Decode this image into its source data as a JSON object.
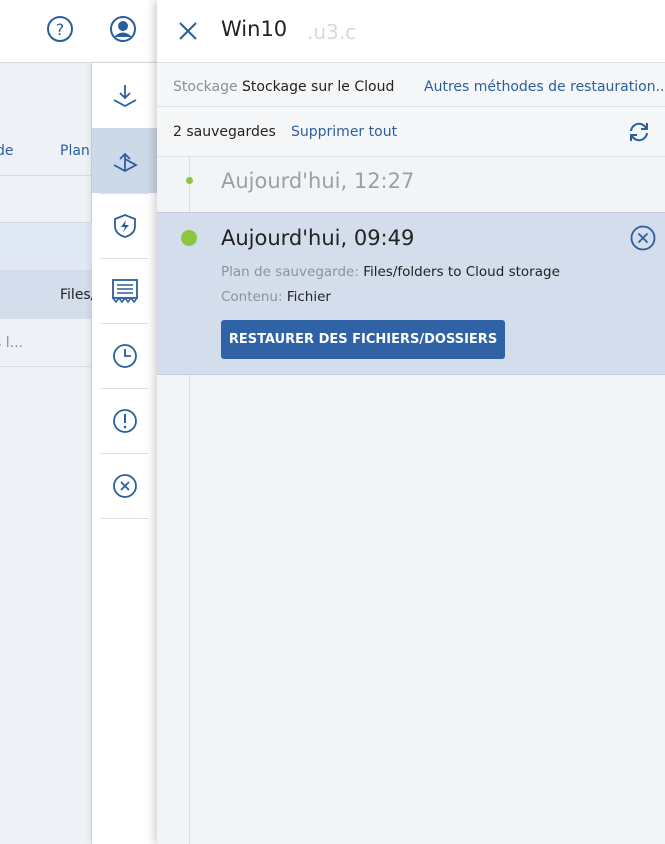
{
  "background": {
    "rows": [
      {
        "col1": "de",
        "col2": "Plan"
      },
      {
        "col1": "",
        "col2": ""
      },
      {
        "col1": "",
        "col2": ""
      },
      {
        "col1": "",
        "col2": "Files/"
      },
      {
        "col1": "s l...",
        "col2": ""
      }
    ]
  },
  "rail": {
    "items": [
      {
        "name": "recovery-download-icon",
        "active": false
      },
      {
        "name": "recover-upload-icon",
        "active": true
      },
      {
        "name": "active-protection-shield-icon",
        "active": false
      },
      {
        "name": "report-document-icon",
        "active": false
      },
      {
        "name": "history-clock-icon",
        "active": false
      },
      {
        "name": "alerts-exclamation-icon",
        "active": false
      },
      {
        "name": "delete-circle-x-icon",
        "active": false
      }
    ]
  },
  "panel": {
    "title": "Win10",
    "title_ghost": ".u3.c",
    "storage_label": "Stockage :",
    "storage_value": "Stockage sur le Cloud",
    "other_methods": "Autres méthodes de restauration...",
    "backup_count": "2 sauvegardes",
    "delete_all": "Supprimer tout"
  },
  "backups": [
    {
      "time": "Aujourd'hui, 12:27"
    },
    {
      "time": "Aujourd'hui, 09:49",
      "plan_label": "Plan de sauvegarde:",
      "plan_value": "Files/folders to Cloud storage",
      "content_label": "Contenu:",
      "content_value": "Fichier",
      "restore_button": "RESTAURER DES FICHIERS/DOSSIERS"
    }
  ],
  "colors": {
    "accent": "#2f63a6",
    "link": "#2a5f9e",
    "dot_green": "#8cc63f",
    "selected_row": "#d3ddeb"
  }
}
